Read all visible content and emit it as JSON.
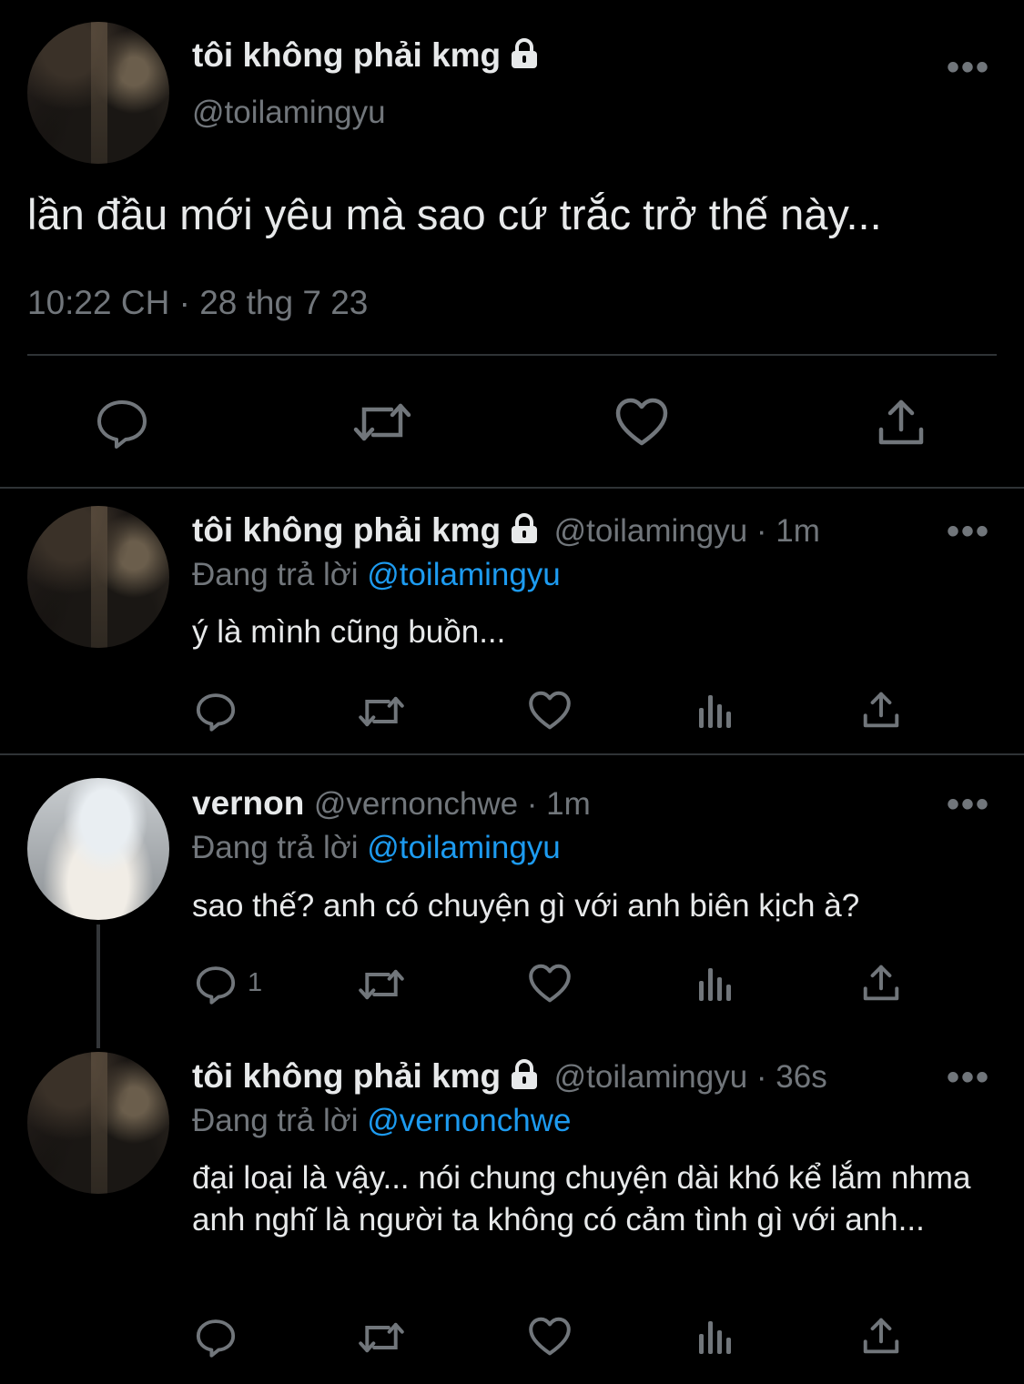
{
  "main_tweet": {
    "name": "tôi không phải kmg",
    "handle": "@toilamingyu",
    "text": "lần đầu mới yêu mà sao cứ trắc trở thế này...",
    "timestamp": "10:22 CH · 28 thg 7 23",
    "more": "•••"
  },
  "replies": [
    {
      "name": "tôi không phải kmg",
      "meta": "@toilamingyu · 1m",
      "reply_prefix": "Đang trả lời",
      "reply_to": "@toilamingyu",
      "text": "ý là mình cũng buồn...",
      "more": "•••"
    },
    {
      "name": "vernon",
      "meta": "@vernonchwe · 1m",
      "reply_prefix": "Đang trả lời",
      "reply_to": "@toilamingyu",
      "text": "sao thế? anh có chuyện gì với anh biên kịch à?",
      "reply_count": "1",
      "more": "•••"
    },
    {
      "name": "tôi không phải kmg",
      "meta": "@toilamingyu · 36s",
      "reply_prefix": "Đang trả lời",
      "reply_to": "@vernonchwe",
      "text": "đại loại là vậy... nói chung chuyện dài khó kể lắm nhma anh nghĩ là người ta không có cảm tình gì với anh...",
      "more": "•••"
    }
  ],
  "icons": [
    "reply-icon",
    "retweet-icon",
    "like-icon",
    "views-icon",
    "share-icon",
    "lock-icon",
    "more-icon"
  ],
  "colors": {
    "background": "#000000",
    "text": "#e7e9ea",
    "secondary": "#71767b",
    "accent": "#1d9bf0",
    "divider": "#2f3336"
  }
}
